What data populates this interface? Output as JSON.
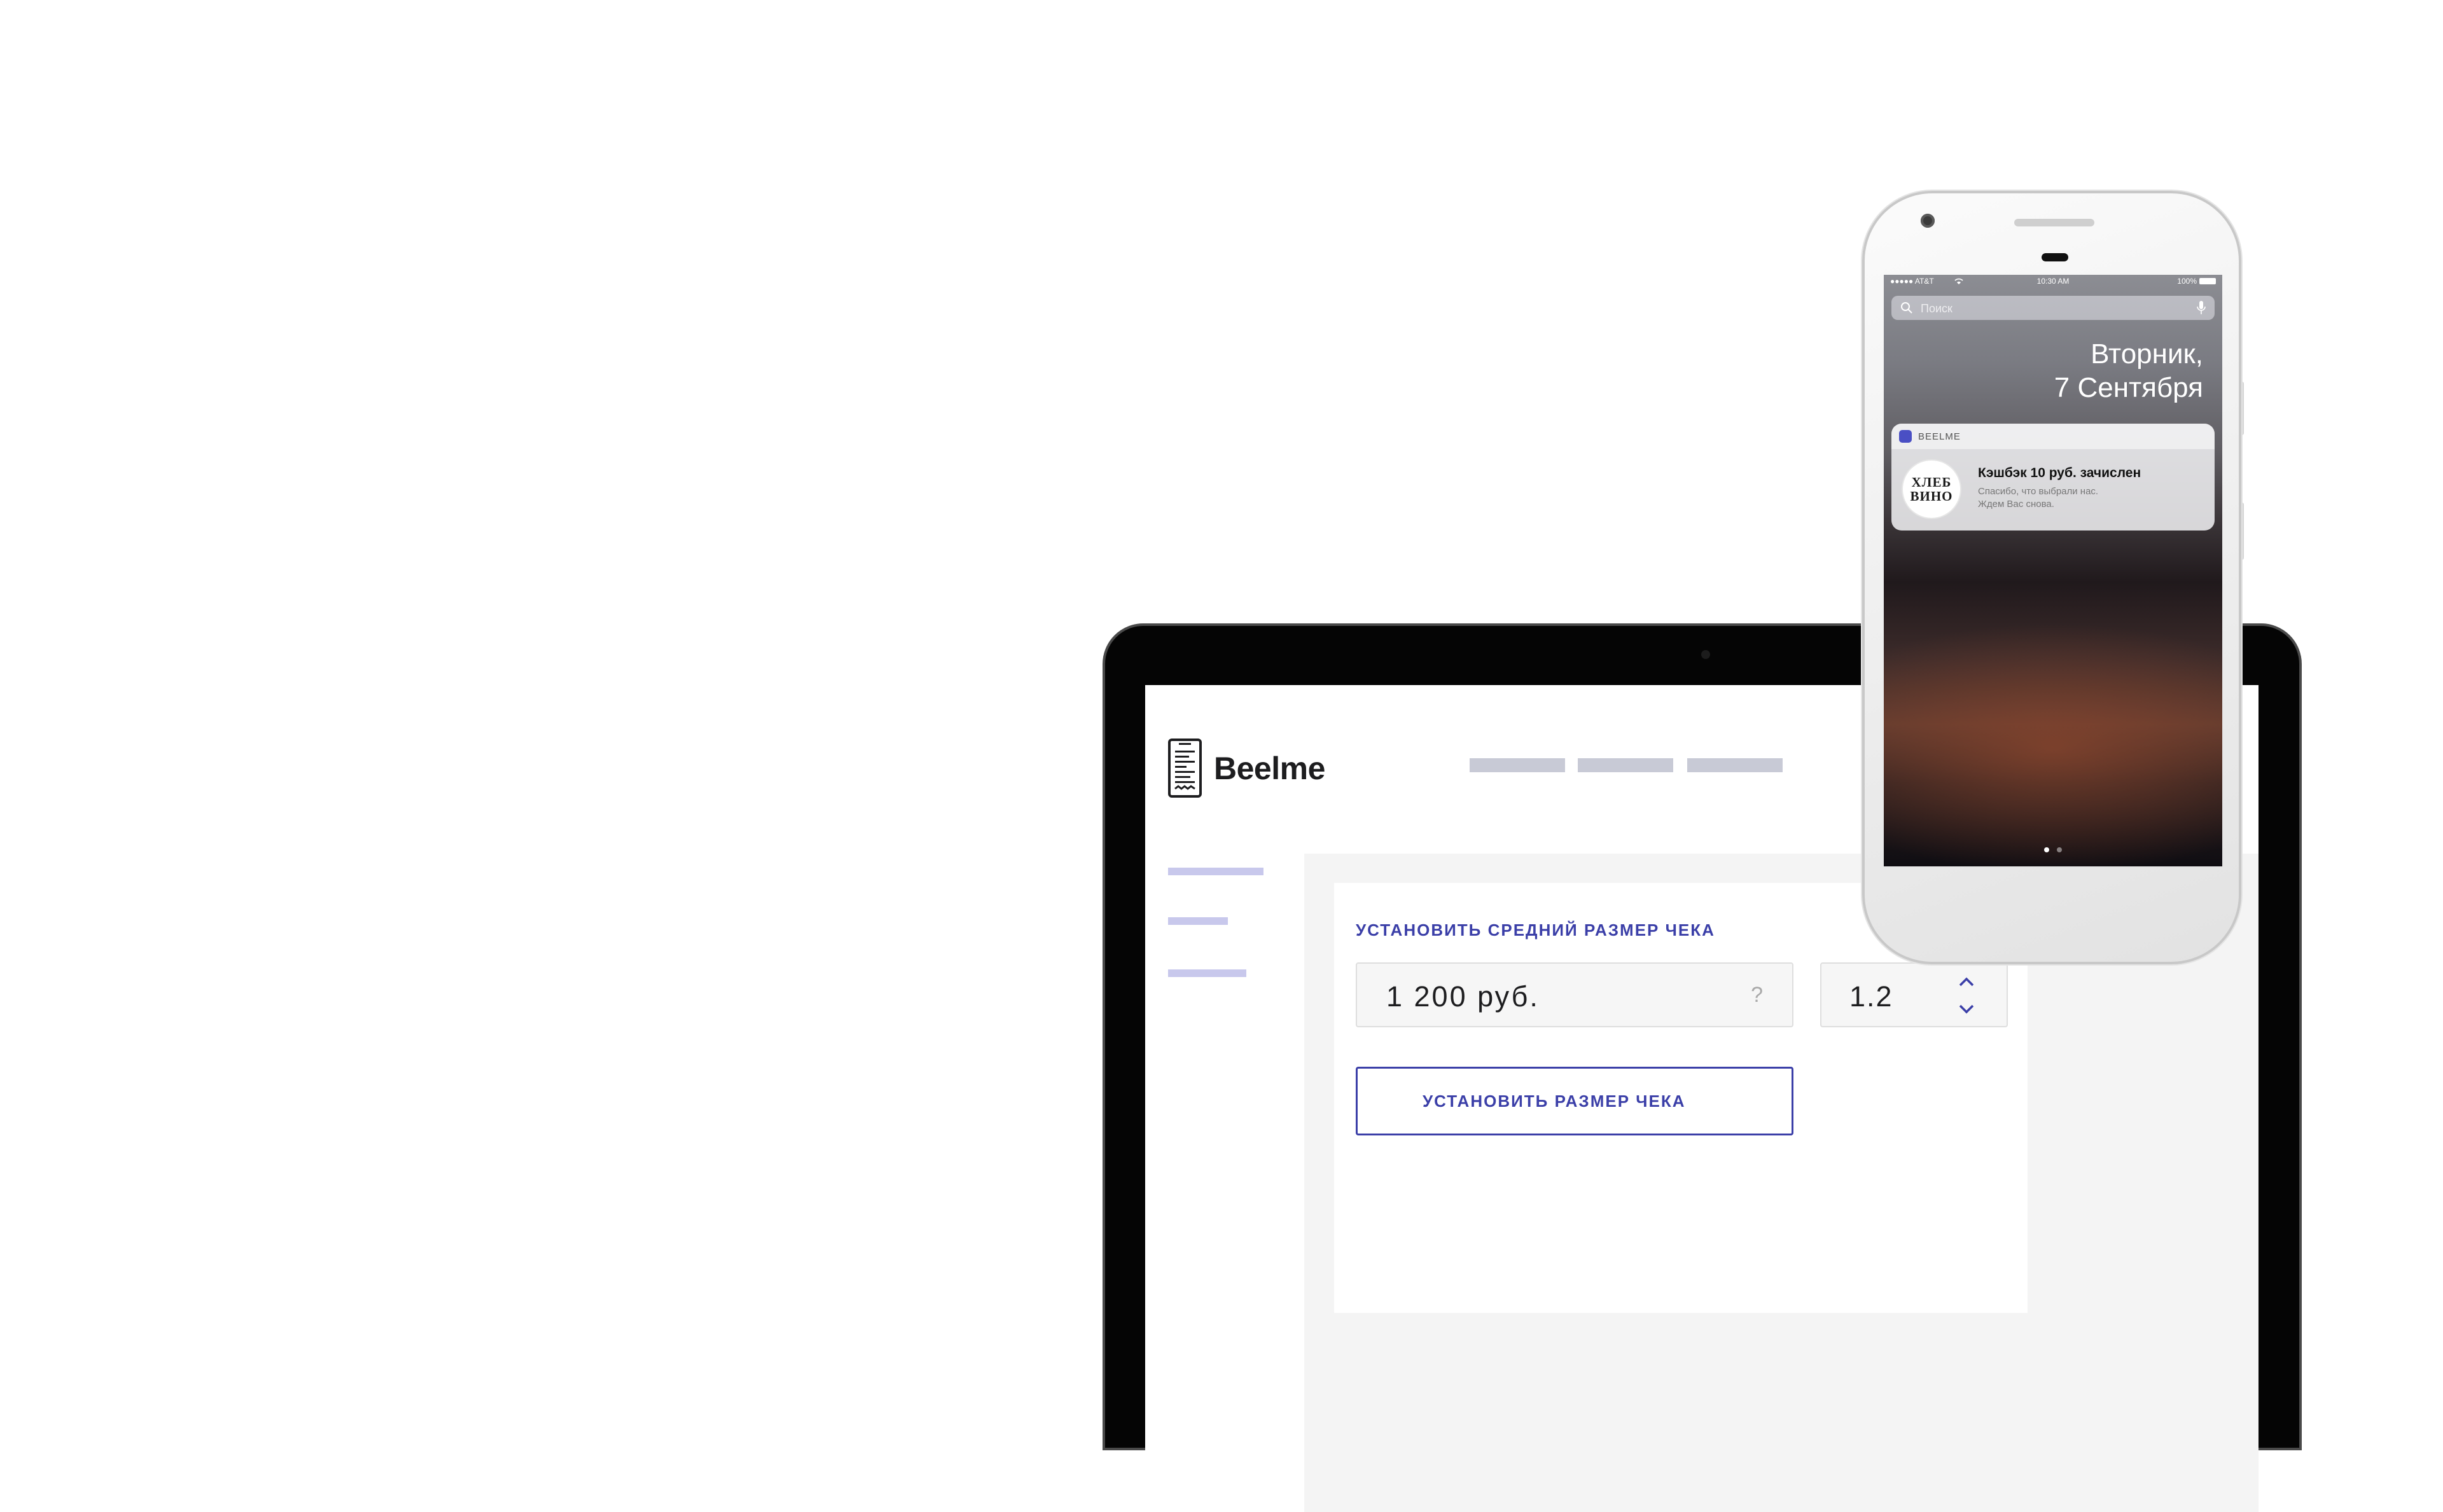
{
  "app": {
    "logo_text": "Beelme"
  },
  "card": {
    "title": "УСТАНОВИТЬ СРЕДНИЙ РАЗМЕР ЧЕКА",
    "amount_value": "1 200 руб.",
    "help_symbol": "?",
    "coefficient_value": "1.2",
    "submit_label": "УСТАНОВИТЬ РАЗМЕР ЧЕКА"
  },
  "phone": {
    "status": {
      "carrier": "●●●●● AT&T",
      "time": "10:30 AM",
      "battery": "100%"
    },
    "search_placeholder": "Поиск",
    "date_line1": "Вторник,",
    "date_line2": "7 Сентября",
    "notification": {
      "app_name": "BEELME",
      "avatar_line1": "ХЛЕБ",
      "avatar_line2": "ВИНО",
      "title": "Кэшбэк 10 руб. зачислен",
      "line1": "Спасибо, что выбрали нас.",
      "line2": "Ждем Вас снова."
    }
  },
  "colors": {
    "accent": "#3b3fa8",
    "nav_placeholder": "#c8cad6",
    "sidebar_placeholder": "#c8c8ec"
  },
  "icons": [
    "receipt-phone-logo-icon",
    "help-icon",
    "chevron-up-icon",
    "chevron-down-icon",
    "search-icon",
    "microphone-icon",
    "wifi-icon",
    "battery-icon"
  ]
}
